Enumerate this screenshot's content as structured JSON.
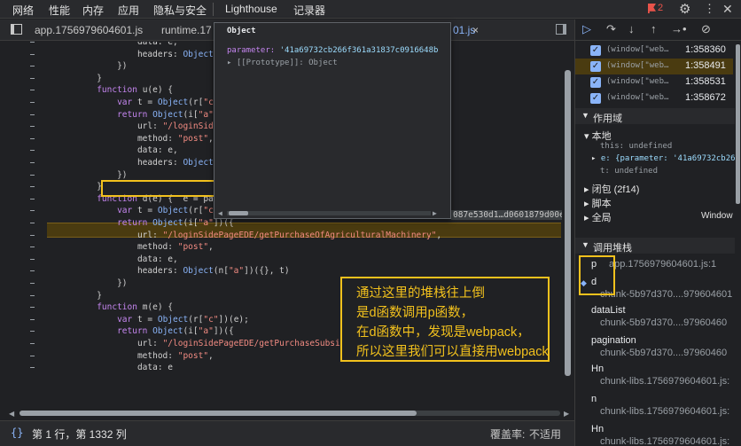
{
  "top_tabs": [
    "网络",
    "性能",
    "内存",
    "应用",
    "隐私与安全",
    "Lighthouse",
    "记录器"
  ],
  "top_right": {
    "badge_count": "2",
    "settings_icon": "gear-icon",
    "menu_icon": "kebab-icon",
    "close_icon": "close-icon",
    "flag_icon": "flag-icon"
  },
  "file_tabs": {
    "tab1": "app.1756979604601.js",
    "tab2": "runtime.17",
    "tab3_tail": "01.js",
    "tab3_close": "×",
    "sidebar_toggle_icon": "sidebar-toggle-icon",
    "collapse_icon": "collapse-icon"
  },
  "code_lines": [
    {
      "t": "                  data: e,"
    },
    {
      "t": "                  headers: Object(n"
    },
    {
      "t": "              })"
    },
    {
      "t": "          }"
    },
    {
      "t": "          function u(e) {"
    },
    {
      "t": "              var t = Object(r[\"c\"])"
    },
    {
      "t": "              return Object(i[\"a\"])"
    },
    {
      "t": "                  url: \"/loginSidePa"
    },
    {
      "t": "                  method: \"post\","
    },
    {
      "t": "                  data: e,"
    },
    {
      "t": "                  headers: Object(n"
    },
    {
      "t": "              })"
    },
    {
      "t": "          }"
    },
    {
      "t": "          function d(e) {  e = par"
    },
    {
      "t": "              var t = Object(r[\"c\"])(e);"
    },
    {
      "t": "              return Object(i[\"a\"])({"
    },
    {
      "t": "                  url: \"/loginSidePageEDE/getPurchaseOfAgriculturalMachinery\","
    },
    {
      "t": "                  method: \"post\","
    },
    {
      "t": "                  data: e,"
    },
    {
      "t": "                  headers: Object(n[\"a\"])({}, t)"
    },
    {
      "t": "              })"
    },
    {
      "t": "          }"
    },
    {
      "t": "          function m(e) {"
    },
    {
      "t": "              var t = Object(r[\"c\"])(e);"
    },
    {
      "t": "              return Object(i[\"a\"])({"
    },
    {
      "t": "                  url: \"/loginSidePageEDE/getPurchaseSubsidyOpenTopMsg\","
    },
    {
      "t": "                  method: \"post\","
    },
    {
      "t": "                  data: e"
    }
  ],
  "inline_value": "087e530d1…d0601879d00e",
  "popup": {
    "header": "Object",
    "param_key": "parameter:",
    "param_val": "'41a69732cb266f361a31837c0916648b",
    "proto": "[[Prototype]]: Object"
  },
  "status": {
    "brace_icon": "{}",
    "position": "第 1 行，第 1332 列",
    "coverage_label": "覆盖率:",
    "coverage_value": "不适用"
  },
  "annotation": [
    "通过这里的堆栈往上倒",
    "是d函数调用p函数，",
    "在d函数中，发现是webpack，",
    "所以这里我们可以直接用webpack"
  ],
  "debugger_tools": [
    "resume-icon",
    "step-over-icon",
    "step-into-icon",
    "step-out-icon",
    "step-icon",
    "deactivate-breakpoints-icon"
  ],
  "breakpoints": [
    {
      "code": "(window[\"web…",
      "line": "1:358360"
    },
    {
      "code": "(window[\"web…",
      "line": "1:358491"
    },
    {
      "code": "(window[\"web…",
      "line": "1:358531"
    },
    {
      "code": "(window[\"web…",
      "line": "1:358672"
    }
  ],
  "scope": {
    "title": "作用域",
    "local": "本地",
    "this_label": "this: undefined",
    "e_label": "e: {parameter: '41a69732cb26",
    "t_label": "t: undefined",
    "closure": "闭包 (2f14)",
    "script": "脚本",
    "global": "全局",
    "global_value": "Window"
  },
  "call_stack": {
    "title": "调用堆栈",
    "frames": [
      {
        "name": "p",
        "loc": "app.1756979604601.js:1"
      },
      {
        "name": "d",
        "loc": "chunk-5b97d370....979604601"
      },
      {
        "name": "dataList",
        "loc": "chunk-5b97d370....97960460"
      },
      {
        "name": "pagination",
        "loc": "chunk-5b97d370....97960460"
      },
      {
        "name": "Hn",
        "loc": "chunk-libs.1756979604601.js:"
      },
      {
        "name": "n",
        "loc": "chunk-libs.1756979604601.js:"
      },
      {
        "name": "Hn",
        "loc": "chunk-libs.1756979604601.js:"
      }
    ]
  }
}
